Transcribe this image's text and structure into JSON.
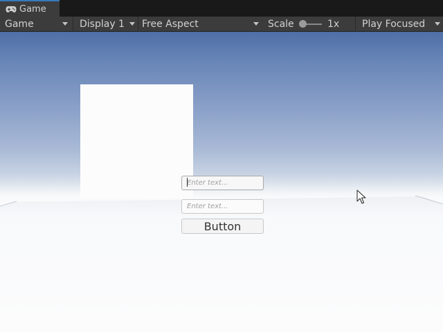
{
  "tab": {
    "label": "Game",
    "icon": "gamepad-icon"
  },
  "toolbar": {
    "view_mode": "Game",
    "display": "Display 1",
    "aspect": "Free Aspect",
    "scale_label": "Scale",
    "scale_value": "1x",
    "scale_slider_fraction": 0.0,
    "play_mode": "Play Focused"
  },
  "game_ui": {
    "input1_placeholder": "Enter text...",
    "input2_placeholder": "Enter text...",
    "button_label": "Button"
  },
  "colors": {
    "tab_accent": "#3a79bb",
    "toolbar_bg": "#3c3c3c",
    "sky_top": "#4e6fa6",
    "ground": "#f6f7f9"
  }
}
